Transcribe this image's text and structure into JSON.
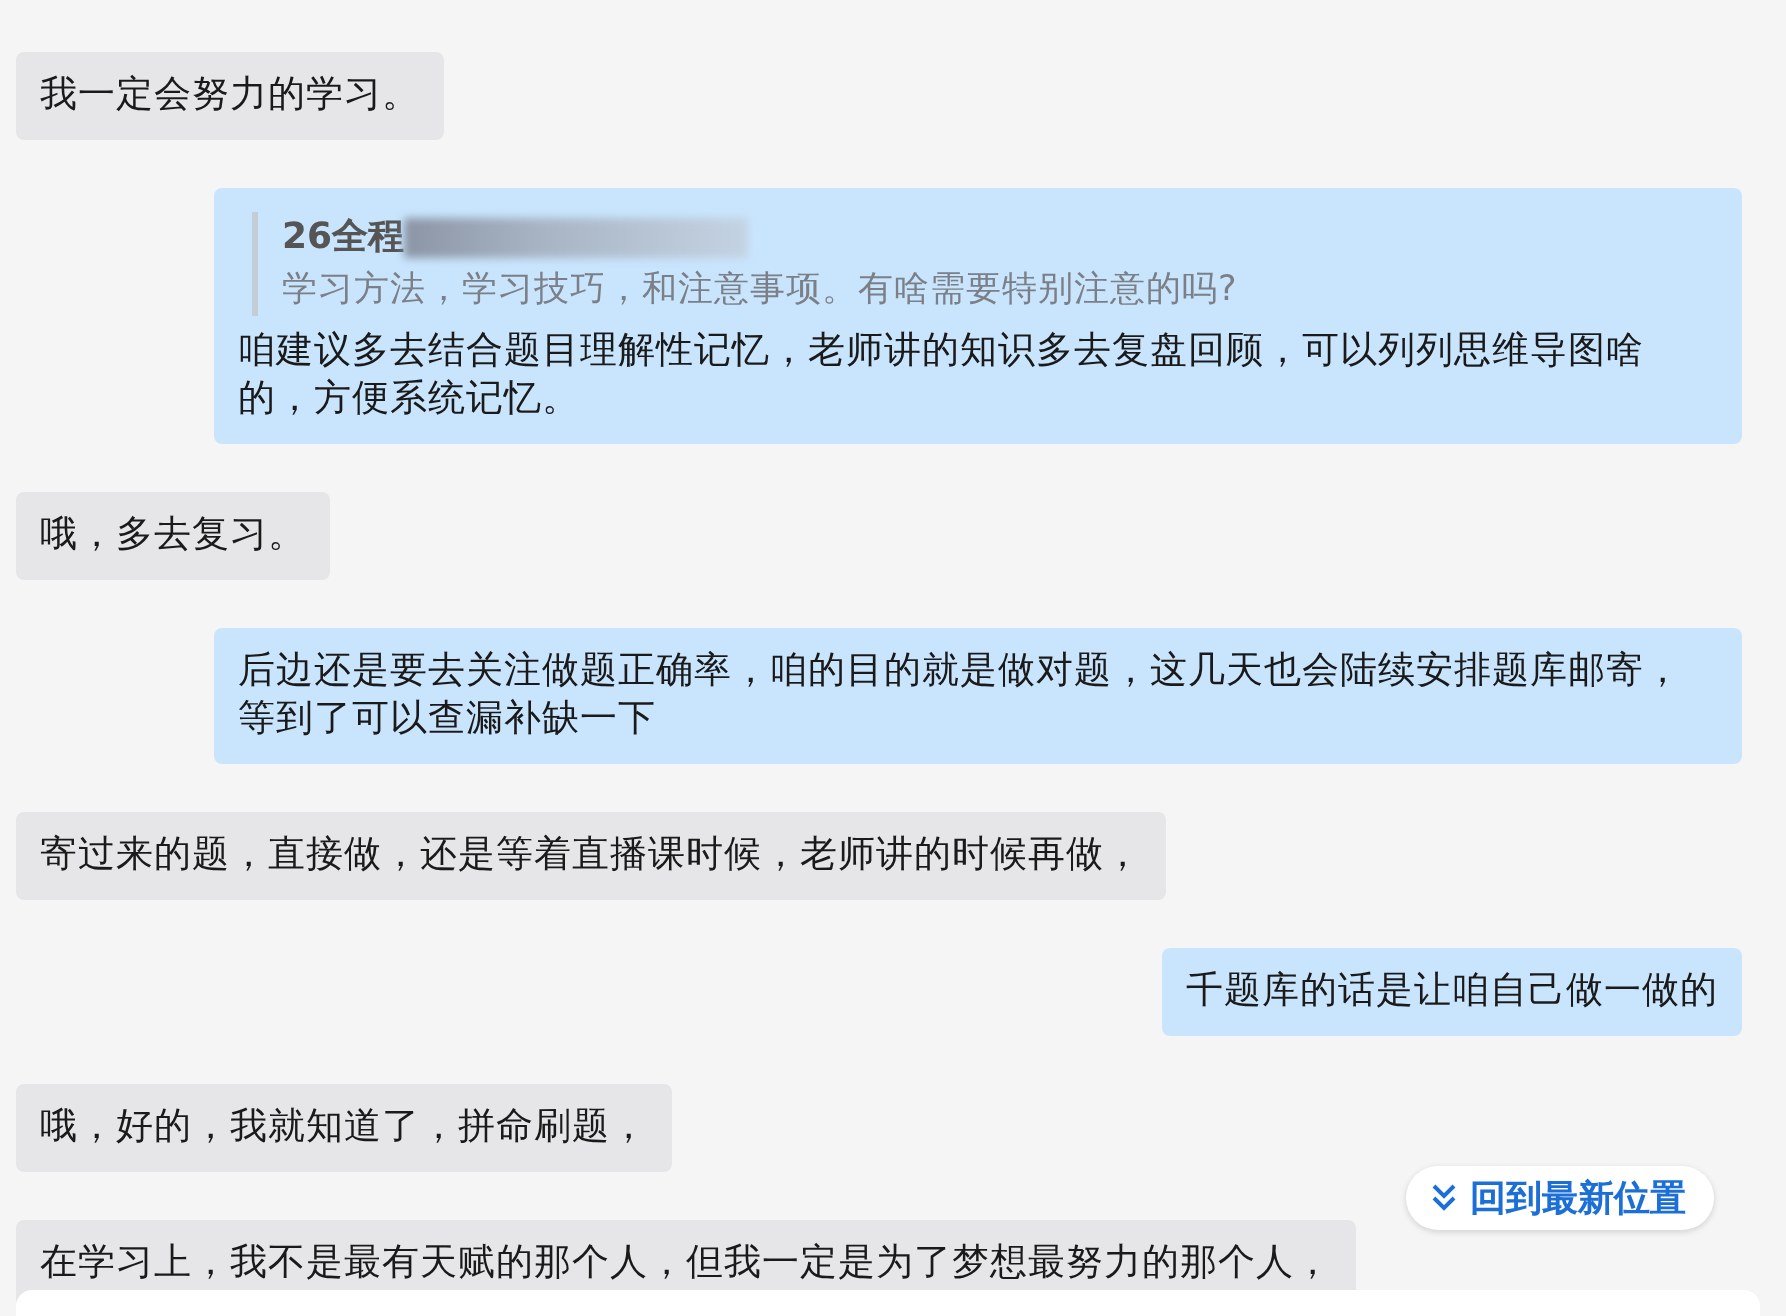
{
  "messages": [
    {
      "outgoing": false,
      "kind": "text",
      "text": "我一定会努力的学习。"
    },
    {
      "outgoing": true,
      "kind": "quote",
      "quote_title": "26全程",
      "quote_redacted": true,
      "quote_text": "学习方法，学习技巧，和注意事项。有啥需要特别注意的吗?",
      "text": "咱建议多去结合题目理解性记忆，老师讲的知识多去复盘回顾，可以列列思维导图啥的，方便系统记忆。"
    },
    {
      "outgoing": false,
      "kind": "text",
      "text": "哦，多去复习。"
    },
    {
      "outgoing": true,
      "kind": "text",
      "text": "后边还是要去关注做题正确率，咱的目的就是做对题，这几天也会陆续安排题库邮寄，等到了可以查漏补缺一下"
    },
    {
      "outgoing": false,
      "kind": "text",
      "text": "寄过来的题，直接做，还是等着直播课时候，老师讲的时候再做，"
    },
    {
      "outgoing": true,
      "kind": "text",
      "text": "千题库的话是让咱自己做一做的"
    },
    {
      "outgoing": false,
      "kind": "text",
      "text": "哦，好的，我就知道了，拼命刷题，"
    },
    {
      "outgoing": false,
      "kind": "text",
      "text": "在学习上，我不是最有天赋的那个人，但我一定是为了梦想最努力的那个人，"
    }
  ],
  "jump_button": {
    "label": "回到最新位置"
  }
}
